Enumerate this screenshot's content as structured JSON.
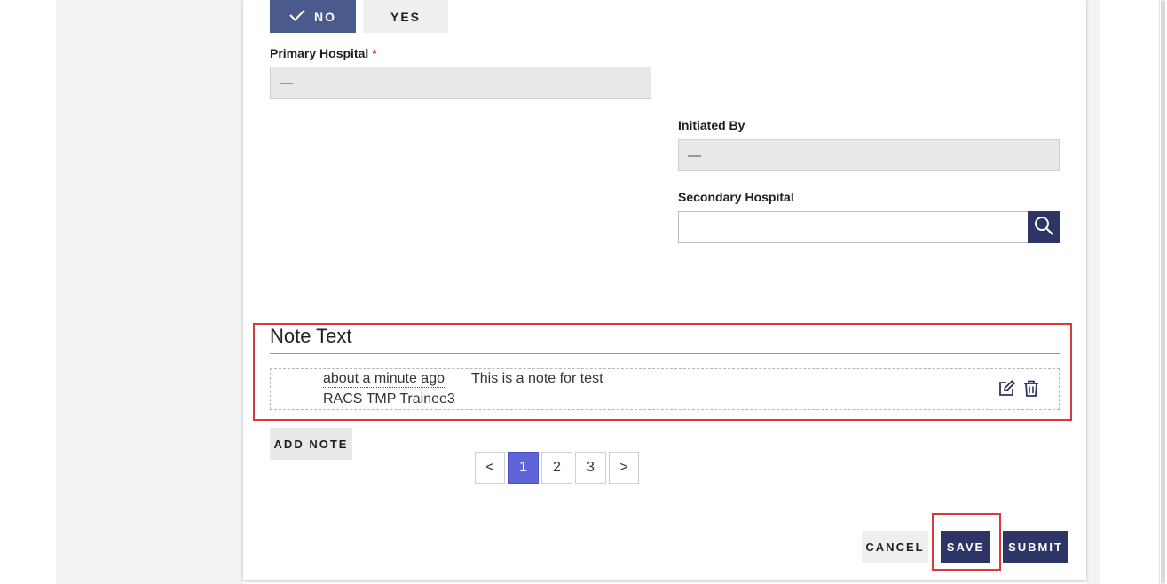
{
  "toggle": {
    "no_label": "NO",
    "yes_label": "YES",
    "selected": "NO"
  },
  "primary_hospital": {
    "label": "Primary Hospital",
    "required_mark": "*",
    "value": "—"
  },
  "initiated_by": {
    "label": "Initiated By",
    "value": "—"
  },
  "secondary_hospital": {
    "label": "Secondary Hospital",
    "value": ""
  },
  "notes": {
    "title": "Note Text",
    "items": [
      {
        "time": "about a minute ago",
        "author": "RACS TMP Trainee3",
        "text": "This is a note for test"
      }
    ],
    "add_label": "ADD NOTE"
  },
  "pagination": {
    "prev": "<",
    "pages": [
      "1",
      "2",
      "3"
    ],
    "current": "1",
    "next": ">"
  },
  "actions": {
    "cancel": "CANCEL",
    "save": "SAVE",
    "submit": "SUBMIT"
  },
  "colors": {
    "primary": "#2e3466",
    "toggle_selected": "#4a5a8c",
    "pager_active": "#5f63d8",
    "highlight": "#d9393b",
    "required": "#c0392b"
  }
}
